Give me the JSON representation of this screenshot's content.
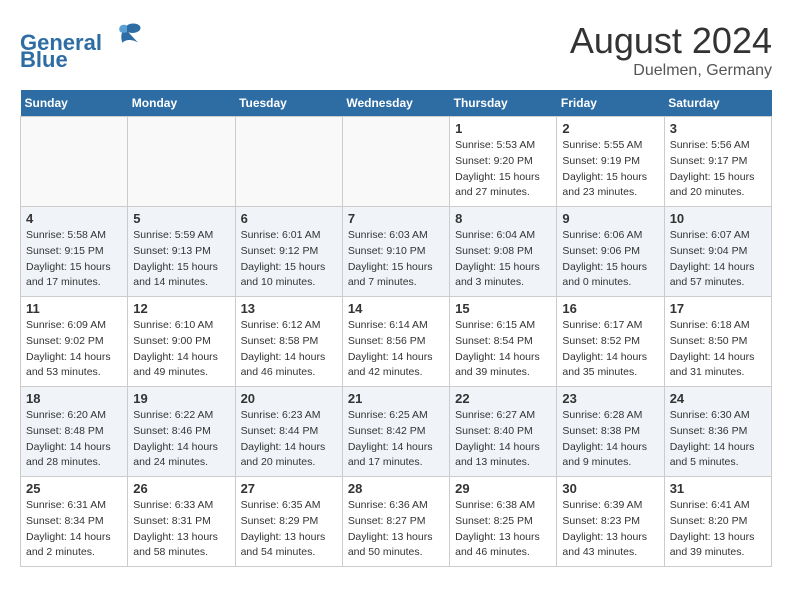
{
  "header": {
    "logo_line1": "General",
    "logo_line2": "Blue",
    "month_year": "August 2024",
    "location": "Duelmen, Germany"
  },
  "weekdays": [
    "Sunday",
    "Monday",
    "Tuesday",
    "Wednesday",
    "Thursday",
    "Friday",
    "Saturday"
  ],
  "weeks": [
    [
      {
        "day": "",
        "info": ""
      },
      {
        "day": "",
        "info": ""
      },
      {
        "day": "",
        "info": ""
      },
      {
        "day": "",
        "info": ""
      },
      {
        "day": "1",
        "info": "Sunrise: 5:53 AM\nSunset: 9:20 PM\nDaylight: 15 hours\nand 27 minutes."
      },
      {
        "day": "2",
        "info": "Sunrise: 5:55 AM\nSunset: 9:19 PM\nDaylight: 15 hours\nand 23 minutes."
      },
      {
        "day": "3",
        "info": "Sunrise: 5:56 AM\nSunset: 9:17 PM\nDaylight: 15 hours\nand 20 minutes."
      }
    ],
    [
      {
        "day": "4",
        "info": "Sunrise: 5:58 AM\nSunset: 9:15 PM\nDaylight: 15 hours\nand 17 minutes."
      },
      {
        "day": "5",
        "info": "Sunrise: 5:59 AM\nSunset: 9:13 PM\nDaylight: 15 hours\nand 14 minutes."
      },
      {
        "day": "6",
        "info": "Sunrise: 6:01 AM\nSunset: 9:12 PM\nDaylight: 15 hours\nand 10 minutes."
      },
      {
        "day": "7",
        "info": "Sunrise: 6:03 AM\nSunset: 9:10 PM\nDaylight: 15 hours\nand 7 minutes."
      },
      {
        "day": "8",
        "info": "Sunrise: 6:04 AM\nSunset: 9:08 PM\nDaylight: 15 hours\nand 3 minutes."
      },
      {
        "day": "9",
        "info": "Sunrise: 6:06 AM\nSunset: 9:06 PM\nDaylight: 15 hours\nand 0 minutes."
      },
      {
        "day": "10",
        "info": "Sunrise: 6:07 AM\nSunset: 9:04 PM\nDaylight: 14 hours\nand 57 minutes."
      }
    ],
    [
      {
        "day": "11",
        "info": "Sunrise: 6:09 AM\nSunset: 9:02 PM\nDaylight: 14 hours\nand 53 minutes."
      },
      {
        "day": "12",
        "info": "Sunrise: 6:10 AM\nSunset: 9:00 PM\nDaylight: 14 hours\nand 49 minutes."
      },
      {
        "day": "13",
        "info": "Sunrise: 6:12 AM\nSunset: 8:58 PM\nDaylight: 14 hours\nand 46 minutes."
      },
      {
        "day": "14",
        "info": "Sunrise: 6:14 AM\nSunset: 8:56 PM\nDaylight: 14 hours\nand 42 minutes."
      },
      {
        "day": "15",
        "info": "Sunrise: 6:15 AM\nSunset: 8:54 PM\nDaylight: 14 hours\nand 39 minutes."
      },
      {
        "day": "16",
        "info": "Sunrise: 6:17 AM\nSunset: 8:52 PM\nDaylight: 14 hours\nand 35 minutes."
      },
      {
        "day": "17",
        "info": "Sunrise: 6:18 AM\nSunset: 8:50 PM\nDaylight: 14 hours\nand 31 minutes."
      }
    ],
    [
      {
        "day": "18",
        "info": "Sunrise: 6:20 AM\nSunset: 8:48 PM\nDaylight: 14 hours\nand 28 minutes."
      },
      {
        "day": "19",
        "info": "Sunrise: 6:22 AM\nSunset: 8:46 PM\nDaylight: 14 hours\nand 24 minutes."
      },
      {
        "day": "20",
        "info": "Sunrise: 6:23 AM\nSunset: 8:44 PM\nDaylight: 14 hours\nand 20 minutes."
      },
      {
        "day": "21",
        "info": "Sunrise: 6:25 AM\nSunset: 8:42 PM\nDaylight: 14 hours\nand 17 minutes."
      },
      {
        "day": "22",
        "info": "Sunrise: 6:27 AM\nSunset: 8:40 PM\nDaylight: 14 hours\nand 13 minutes."
      },
      {
        "day": "23",
        "info": "Sunrise: 6:28 AM\nSunset: 8:38 PM\nDaylight: 14 hours\nand 9 minutes."
      },
      {
        "day": "24",
        "info": "Sunrise: 6:30 AM\nSunset: 8:36 PM\nDaylight: 14 hours\nand 5 minutes."
      }
    ],
    [
      {
        "day": "25",
        "info": "Sunrise: 6:31 AM\nSunset: 8:34 PM\nDaylight: 14 hours\nand 2 minutes."
      },
      {
        "day": "26",
        "info": "Sunrise: 6:33 AM\nSunset: 8:31 PM\nDaylight: 13 hours\nand 58 minutes."
      },
      {
        "day": "27",
        "info": "Sunrise: 6:35 AM\nSunset: 8:29 PM\nDaylight: 13 hours\nand 54 minutes."
      },
      {
        "day": "28",
        "info": "Sunrise: 6:36 AM\nSunset: 8:27 PM\nDaylight: 13 hours\nand 50 minutes."
      },
      {
        "day": "29",
        "info": "Sunrise: 6:38 AM\nSunset: 8:25 PM\nDaylight: 13 hours\nand 46 minutes."
      },
      {
        "day": "30",
        "info": "Sunrise: 6:39 AM\nSunset: 8:23 PM\nDaylight: 13 hours\nand 43 minutes."
      },
      {
        "day": "31",
        "info": "Sunrise: 6:41 AM\nSunset: 8:20 PM\nDaylight: 13 hours\nand 39 minutes."
      }
    ]
  ]
}
